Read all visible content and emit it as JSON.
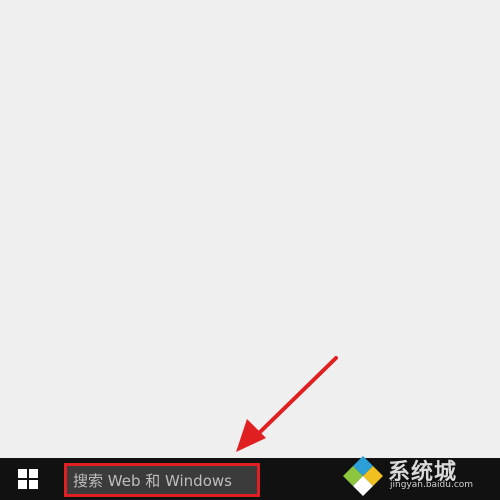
{
  "taskbar": {
    "start_icon": "windows-logo-icon",
    "search": {
      "placeholder": "搜索 Web 和 Windows"
    }
  },
  "annotation": {
    "highlight_color": "#e02020",
    "arrow_color": "#e02020"
  },
  "watermark": {
    "text": "系统城",
    "subtext": "jingyan.baidu.com",
    "logo": "colored-diamond-logo"
  }
}
